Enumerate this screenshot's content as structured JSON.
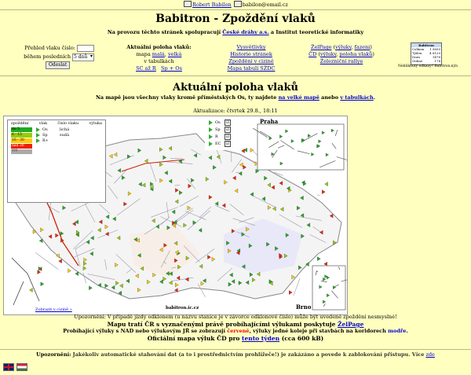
{
  "topline": {
    "author": "Robert Babilon",
    "email": "babilon@email.cz"
  },
  "header": {
    "title": "Babitron - Zpoždění vlaků",
    "partner_prefix": "Na provozu těchto stránek spolupracují",
    "partner_link1": "České dráhy a.s.",
    "partner_mid": "a Institut teoretické informatiky"
  },
  "form": {
    "label_train": "Přehled vlaku číslo:",
    "label_period": "během posledních",
    "period_value": "5 dnů",
    "submit": "Odeslat",
    "train_value": ""
  },
  "poloha": {
    "title": "Aktuální poloha vlaků:",
    "map_prefix": "mapa",
    "map_small": "malá",
    "map_big": "velká",
    "tables": "v tabulkách",
    "sc": "SC až R",
    "sp": "Sp + Os"
  },
  "mid_links": [
    "Vysvětlivky",
    "Historie stránek",
    "Zpoždění v cizině",
    "Mapa tabulí SŽDC"
  ],
  "right_links": {
    "zelpage": "ŽelPage",
    "zel_suffix1": "výluky",
    "zel_suffix2": "fazeni",
    "cd": "ČD",
    "cd_suffix1": "výluky",
    "cd_suffix2": "poloha vlaků",
    "rally": "Železniční rallye"
  },
  "stats": {
    "header": "Babitron",
    "rows": [
      [
        "Celkem",
        "1 5650"
      ],
      [
        "Týden",
        "4 8120"
      ],
      [
        "Dnes",
        "1478"
      ],
      [
        "Online",
        "174"
      ]
    ]
  },
  "counter": "Nebliknutý odkazy? Babitron.nýn",
  "main": {
    "heading": "Aktuální poloha vlaků",
    "subinfo_prefix": "Na mapě jsou všechny vlaky kromě příměstských Os, ty najdete",
    "subinfo_link1": "na velké mapě",
    "subinfo_mid": "anebo",
    "subinfo_link2": "v tabulkách",
    "updated": "Aktualizace: čtvrtek 29.8., 18:11"
  },
  "legend": {
    "headers": [
      "zpoždění",
      "vlak",
      "číslo vlaku",
      "výluka"
    ],
    "rows": [
      {
        "range": "do 5",
        "color": "#22aa22",
        "type": "Os",
        "num": "lichá"
      },
      {
        "range": "6 - 15",
        "color": "#99cc00",
        "type": "Sp",
        "num": "sudá"
      },
      {
        "range": "16 - 30",
        "color": "#ffcc00",
        "type": "R+",
        "num": ""
      },
      {
        "range": "nad 30",
        "color": "#ee2200",
        "type": "",
        "num": ""
      },
      {
        "range": "???",
        "color": "#aaaaaa",
        "type": "",
        "num": ""
      }
    ]
  },
  "categories": [
    {
      "label": "Os",
      "checked": "☑"
    },
    {
      "label": "Sp",
      "checked": "☑"
    },
    {
      "label": "R",
      "checked": "☑"
    },
    {
      "label": "EC",
      "checked": "☑"
    }
  ],
  "map_labels": {
    "praha": "Praha",
    "brno": "Brno",
    "watermark": "babitron.ic.cz",
    "big_map": "Zobrazit v cizině »"
  },
  "notes": {
    "l1": "Upozornění: V případě jízdy odklonem (u názvu stanice je v závorce odklonové číslo) může být uvedené zpoždění nesmyslné!",
    "l2_prefix": "Mapu tratí ČR s vyznačenými právě probíhajícími výlukami poskytuje",
    "l2_link": "ŽelPage",
    "l3_prefix": "Probíhající výluky s NAD nebo výlukovým JŘ se zobrazují",
    "l3_red": "červeně",
    "l3_mid": ", výluky jedné koleje při stavbách na koridorech",
    "l3_blue": "modře",
    "l4_prefix": "Oficiální mapa výluk ČD pro",
    "l4_link": "tento týden",
    "l4_suffix": "(cca 600 kB)"
  },
  "warning": {
    "label": "Upozornění:",
    "text": "Jakékoliv automatické stahování dat (a to i prostřednictvím prohlížeče!) je zakázáno a povede k zablokování přístupu. Více",
    "link": "zde"
  }
}
